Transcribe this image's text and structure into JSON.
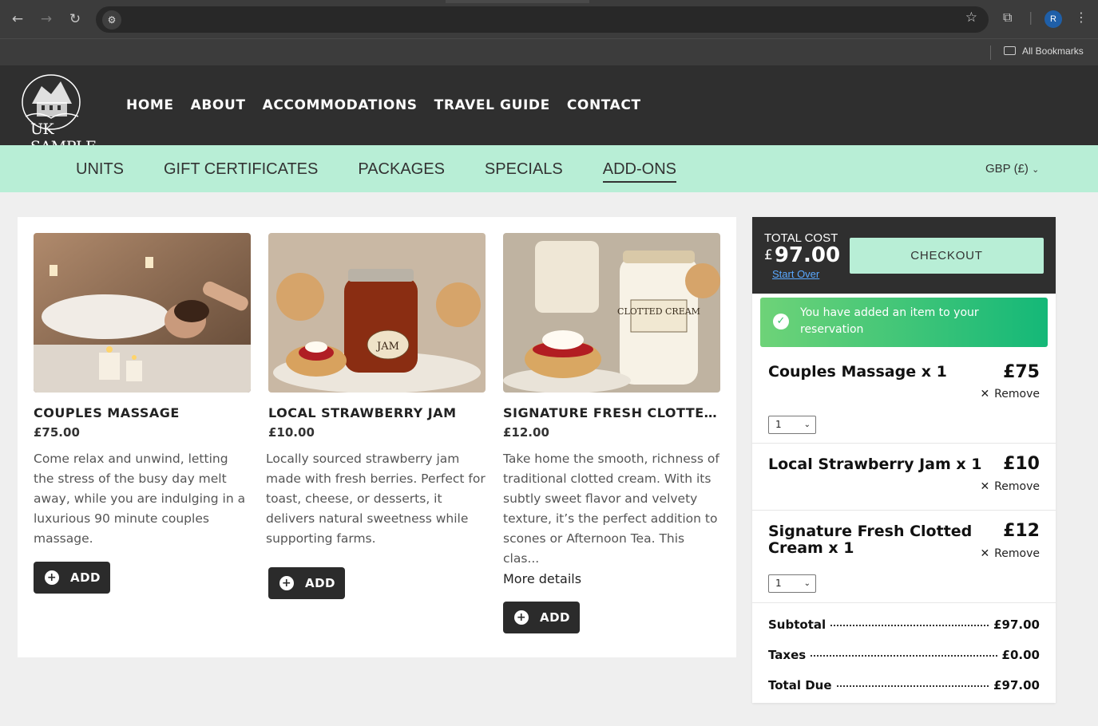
{
  "browser": {
    "bookmarks_label": "All Bookmarks",
    "avatar_letter": "R"
  },
  "site": {
    "logo_text": "UK SAMPLE",
    "main_nav": [
      "HOME",
      "ABOUT",
      "ACCOMMODATIONS",
      "TRAVEL GUIDE",
      "CONTACT"
    ],
    "sub_nav": [
      "UNITS",
      "GIFT CERTIFICATES",
      "PACKAGES",
      "SPECIALS",
      "ADD-ONS"
    ],
    "sub_nav_active": "ADD-ONS",
    "currency": "GBP (£)"
  },
  "products": [
    {
      "name": "COUPLES MASSAGE",
      "price": "£75.00",
      "description": "Come relax and unwind, letting the stress of the busy day melt away, while you are indulging in a luxurious 90 minute couples massage.",
      "add_label": "ADD"
    },
    {
      "name": "LOCAL STRAWBERRY JAM",
      "price": "£10.00",
      "description": "Locally sourced strawberry jam made with fresh berries. Perfect for toast, cheese, or desserts, it delivers natural sweetness while supporting farms.",
      "add_label": "ADD",
      "image_label": "JAM"
    },
    {
      "name": "SIGNATURE FRESH CLOTTED CREAM",
      "price": "£12.00",
      "description": "Take home the smooth, richness of traditional clotted cream. With its subtly sweet flavor and velvety texture, it’s the perfect addition to scones or Afternoon Tea. This clas...",
      "more_details": "More details",
      "add_label": "ADD",
      "image_label": "CLOTTED CREAM"
    }
  ],
  "cart": {
    "total_label": "TOTAL COST",
    "currency_symbol": "£",
    "total_amount": "97.00",
    "start_over": "Start Over",
    "checkout_label": "CHECKOUT",
    "alert_text": "You have added an item to your reservation",
    "items": [
      {
        "name": "Couples Massage x 1",
        "price": "£75",
        "remove": "Remove",
        "qty": "1"
      },
      {
        "name": "Local Strawberry Jam x 1",
        "price": "£10",
        "remove": "Remove"
      },
      {
        "name": "Signature Fresh Clotted Cream x 1",
        "price": "£12",
        "remove": "Remove",
        "qty": "1"
      }
    ],
    "summary": {
      "subtotal_label": "Subtotal",
      "subtotal": "£97.00",
      "taxes_label": "Taxes",
      "taxes": "£0.00",
      "total_due_label": "Total Due",
      "total_due": "£97.00"
    }
  },
  "colors": {
    "header_bg": "#2f2f2f",
    "subnav_bg": "#b8eed6",
    "checkout_bg": "#b8eed6",
    "alert_green": "#14b878"
  }
}
